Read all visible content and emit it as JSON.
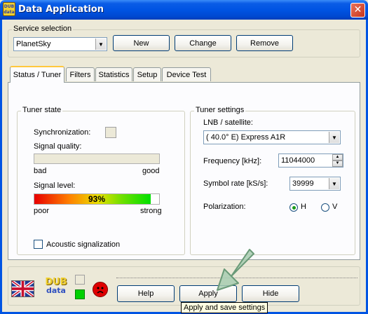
{
  "window": {
    "title": "Data Application",
    "logo_text": "DUB data",
    "close_glyph": "✕"
  },
  "service": {
    "group_label": "Service selection",
    "selected": "PlanetSky",
    "new_label": "New",
    "change_label": "Change",
    "remove_label": "Remove"
  },
  "tabs": [
    {
      "label": "Status / Tuner",
      "active": true
    },
    {
      "label": "Filters"
    },
    {
      "label": "Statistics"
    },
    {
      "label": "Setup"
    },
    {
      "label": "Device Test"
    }
  ],
  "tuner_state": {
    "group_label": "Tuner state",
    "sync_label": "Synchronization:",
    "signal_quality_label": "Signal quality:",
    "quality_bad": "bad",
    "quality_good": "good",
    "quality_value": 0,
    "signal_level_label": "Signal level:",
    "signal_level_text": "93%",
    "signal_level_value": 0.93,
    "level_poor": "poor",
    "level_strong": "strong",
    "acoustic_label": "Acoustic signalization"
  },
  "tuner_settings": {
    "group_label": "Tuner settings",
    "lnb_label": "LNB / satellite:",
    "lnb_value": "(  40.0° E) Express A1R",
    "frequency_label": "Frequency [kHz]:",
    "frequency_value": "11044000",
    "symbol_rate_label": "Symbol rate [kS/s]:",
    "symbol_rate_value": "39999",
    "polarization_label": "Polarization:",
    "pol_h": "H",
    "pol_v": "V",
    "pol_selected": "H"
  },
  "bottom": {
    "help_label": "Help",
    "apply_label": "Apply",
    "hide_label": "Hide",
    "logo_text_top": "DUB",
    "logo_text_bottom": "data",
    "tooltip": "Apply and save settings"
  },
  "colors": {
    "accent": "#0054e3",
    "status_ok": "#00d000",
    "status_error": "#e00000"
  }
}
